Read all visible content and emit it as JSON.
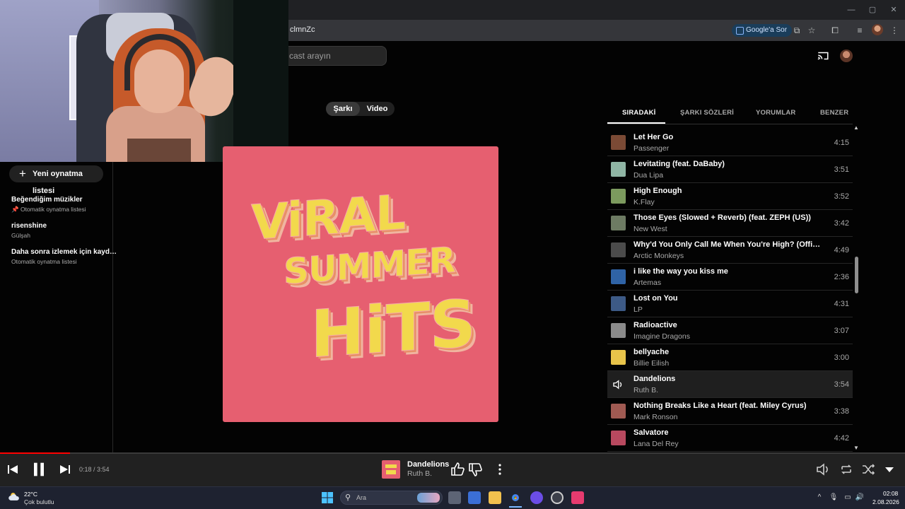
{
  "browser": {
    "url_fragment": "clmnZc",
    "google_ask_label": "Google'a Sor",
    "window_controls": [
      "—",
      "▢",
      "✕"
    ]
  },
  "header": {
    "search_placeholder": "cast arayın"
  },
  "mode_toggle": {
    "song_label": "Şarkı",
    "video_label": "Video"
  },
  "sidebar": {
    "new_playlist_label": "Yeni oynatma listesi",
    "playlists": [
      {
        "title": "Beğendiğim müzikler",
        "subtitle": "Otomatik oynatma listesi",
        "pinned": true
      },
      {
        "title": "risenshine",
        "subtitle": "Gülşah",
        "pinned": false
      },
      {
        "title": "Daha sonra izlemek için kayd…",
        "subtitle": "Otomatik oynatma listesi",
        "pinned": false
      }
    ]
  },
  "album_art": {
    "lines": [
      "ViRAL",
      "SUMMER",
      "HiTS"
    ],
    "background_color": "#e65f70",
    "text_color": "#f2d94c"
  },
  "right_panel": {
    "tabs": [
      "SIRADAKİ",
      "ŞARKI SÖZLERİ",
      "YORUMLAR",
      "BENZER"
    ],
    "active_tab_index": 0,
    "queue": [
      {
        "title": "Let Her Go",
        "artist": "Passenger",
        "duration": "4:15",
        "thumb_color": "#7b4a35",
        "active": false
      },
      {
        "title": "Levitating (feat. DaBaby)",
        "artist": "Dua Lipa",
        "duration": "3:51",
        "thumb_color": "#8fb5a4",
        "active": false
      },
      {
        "title": "High Enough",
        "artist": "K.Flay",
        "duration": "3:52",
        "thumb_color": "#7c9a5e",
        "active": false
      },
      {
        "title": "Those Eyes (Slowed + Reverb) (feat. ZEPH (US))",
        "artist": "New West",
        "duration": "3:42",
        "thumb_color": "#6d7b63",
        "active": false
      },
      {
        "title": "Why'd You Only Call Me When You're High? (Official Vi…",
        "artist": "Arctic Monkeys",
        "duration": "4:49",
        "thumb_color": "#4b4b4b",
        "active": false
      },
      {
        "title": "i like the way you kiss me",
        "artist": "Artemas",
        "duration": "2:36",
        "thumb_color": "#2f63a6",
        "active": false
      },
      {
        "title": "Lost on You",
        "artist": "LP",
        "duration": "4:31",
        "thumb_color": "#3d5a86",
        "active": false
      },
      {
        "title": "Radioactive",
        "artist": "Imagine Dragons",
        "duration": "3:07",
        "thumb_color": "#8a8a8a",
        "active": false
      },
      {
        "title": "bellyache",
        "artist": "Billie Eilish",
        "duration": "3:00",
        "thumb_color": "#e8c44a",
        "active": false
      },
      {
        "title": "Dandelions",
        "artist": "Ruth B.",
        "duration": "3:54",
        "thumb_color": "#1f1f1f",
        "active": true
      },
      {
        "title": "Nothing Breaks Like a Heart (feat. Miley Cyrus)",
        "artist": "Mark Ronson",
        "duration": "3:38",
        "thumb_color": "#a05a52",
        "active": false
      },
      {
        "title": "Salvatore",
        "artist": "Lana Del Rey",
        "duration": "4:42",
        "thumb_color": "#b8495f",
        "active": false
      }
    ]
  },
  "player": {
    "time_text": "0:18 / 3:54",
    "progress_fraction": 0.077,
    "now_title": "Dandelions",
    "now_artist": "Ruth B."
  },
  "taskbar": {
    "weather_temp": "22°C",
    "weather_desc": "Çok bulutlu",
    "search_placeholder": "Ara",
    "clock_time": "02:08",
    "clock_date": "2.08.2026"
  }
}
